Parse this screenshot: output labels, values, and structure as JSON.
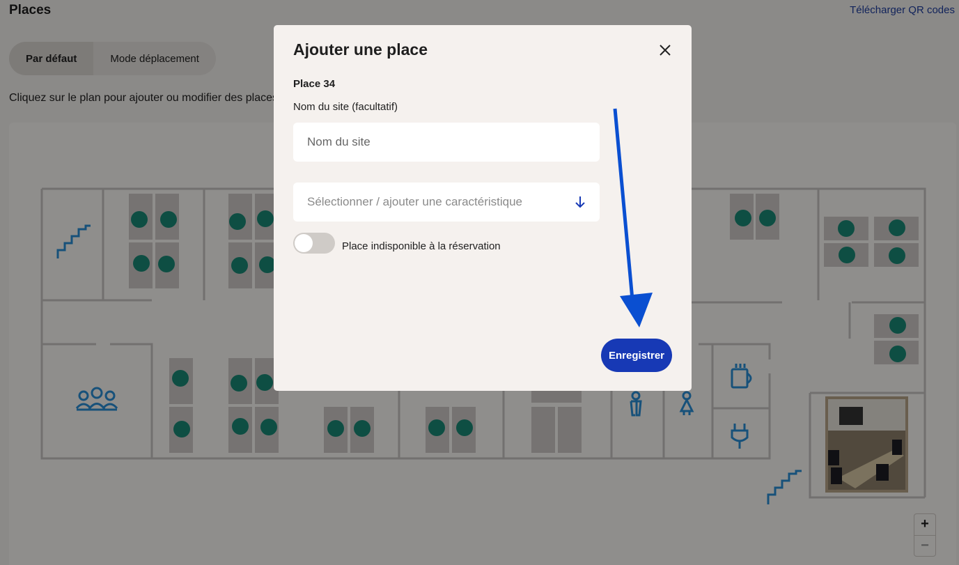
{
  "header": {
    "title": "Places",
    "qr_link": "Télécharger QR codes"
  },
  "modes": {
    "default_label": "Par défaut",
    "move_label": "Mode déplacement"
  },
  "instructions": "Cliquez sur le plan pour ajouter ou modifier des places",
  "zoom": {
    "in_label": "+",
    "out_label": "−"
  },
  "modal": {
    "title": "Ajouter une place",
    "place_number": "Place 34",
    "site_name_label": "Nom du site (facultatif)",
    "site_name_value": "",
    "site_name_placeholder": "Nom du site",
    "characteristic_placeholder": "Sélectionner / ajouter une caractéristique",
    "unavailable_toggle_label": "Place indisponible à la réservation",
    "unavailable_toggle_on": false,
    "save_label": "Enregistrer"
  },
  "colors": {
    "accent": "#1739b5",
    "seat": "#1a8a77",
    "annotation_arrow": "#0a4fd1",
    "plan_icon": "#2a8fd6"
  }
}
